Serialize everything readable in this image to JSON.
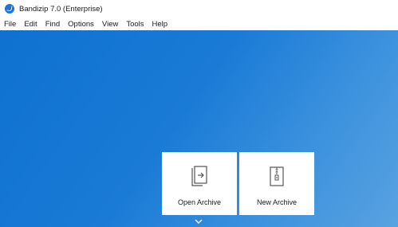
{
  "window": {
    "title": "Bandizip 7.0 (Enterprise)",
    "app_icon": "bandizip-logo-icon"
  },
  "menu": {
    "items": [
      "File",
      "Edit",
      "Find",
      "Options",
      "View",
      "Tools",
      "Help"
    ]
  },
  "start_screen": {
    "open_archive": {
      "label": "Open Archive",
      "icon": "open-archive-icon"
    },
    "new_archive": {
      "label": "New Archive",
      "icon": "new-archive-icon"
    },
    "expand_icon": "chevron-down-icon"
  },
  "colors": {
    "background_start": "#0f71d0",
    "background_end": "#58a2e0",
    "card": "#ffffff",
    "text": "#1a1a1a"
  }
}
